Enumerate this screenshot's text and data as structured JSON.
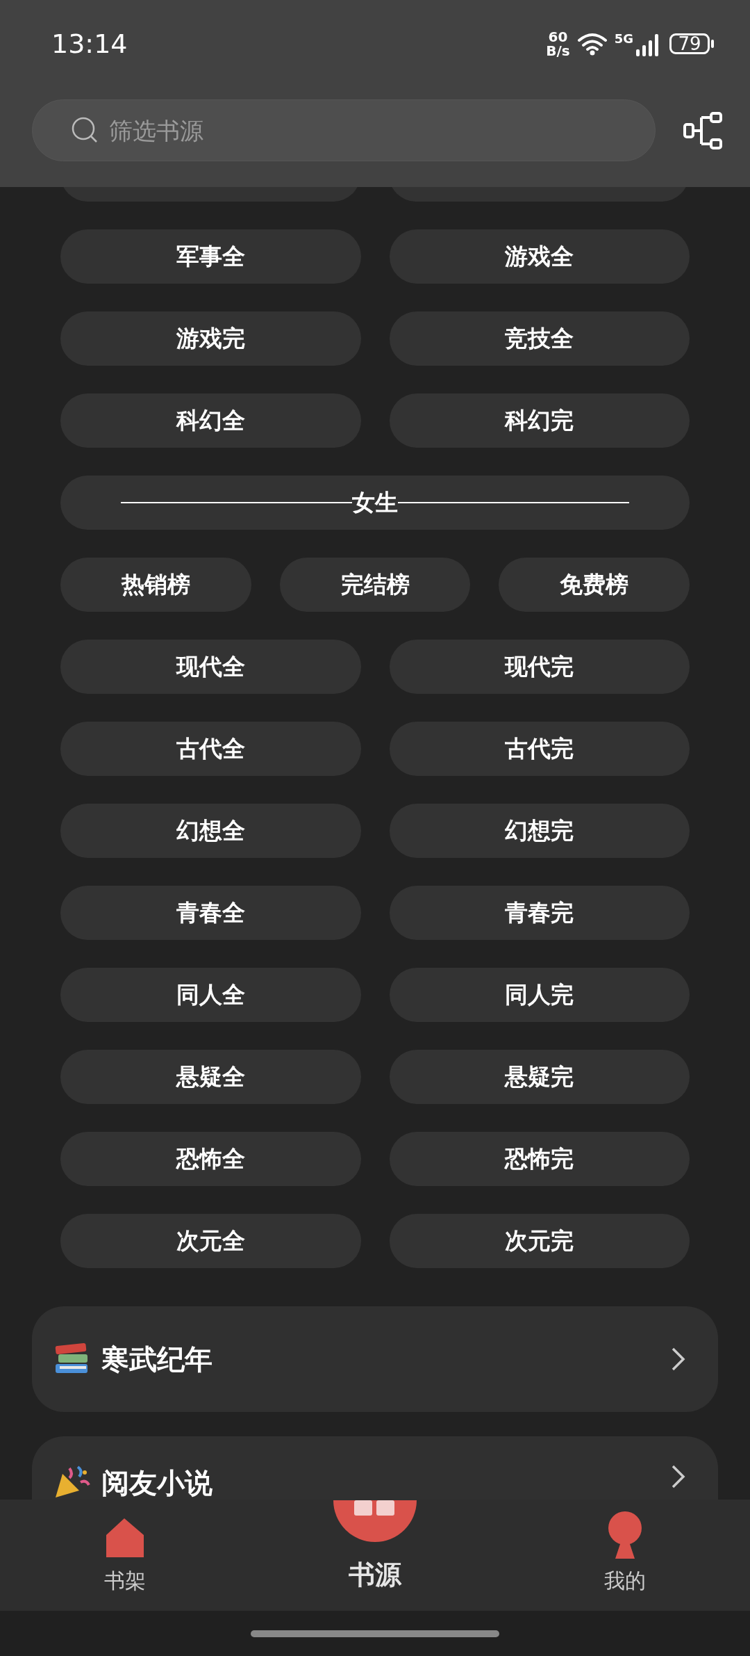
{
  "status_bar": {
    "time": "13:14",
    "net_speed_value": "60",
    "net_speed_unit": "B/s",
    "network": "5G",
    "battery": "79"
  },
  "search": {
    "placeholder": "筛选书源"
  },
  "rows": [
    {
      "kind": "cut_row"
    },
    {
      "kind": "chips",
      "items": [
        "军事全",
        "游戏全"
      ]
    },
    {
      "kind": "chips",
      "items": [
        "游戏完",
        "竞技全"
      ]
    },
    {
      "kind": "chips",
      "items": [
        "科幻全",
        "科幻完"
      ]
    },
    {
      "kind": "divider",
      "label": "女生"
    },
    {
      "kind": "chips",
      "items": [
        "热销榜",
        "完结榜",
        "免费榜"
      ]
    },
    {
      "kind": "chips",
      "items": [
        "现代全",
        "现代完"
      ]
    },
    {
      "kind": "chips",
      "items": [
        "古代全",
        "古代完"
      ]
    },
    {
      "kind": "chips",
      "items": [
        "幻想全",
        "幻想完"
      ]
    },
    {
      "kind": "chips",
      "items": [
        "青春全",
        "青春完"
      ]
    },
    {
      "kind": "chips",
      "items": [
        "同人全",
        "同人完"
      ]
    },
    {
      "kind": "chips",
      "items": [
        "悬疑全",
        "悬疑完"
      ]
    },
    {
      "kind": "chips",
      "items": [
        "恐怖全",
        "恐怖完"
      ]
    },
    {
      "kind": "chips",
      "items": [
        "次元全",
        "次元完"
      ]
    }
  ],
  "cards": [
    {
      "title": "寒武纪年"
    },
    {
      "title": "阅友小说"
    }
  ],
  "bottom_nav": [
    {
      "label": "书架",
      "selected": false
    },
    {
      "label": "书源",
      "selected": true
    },
    {
      "label": "我的",
      "selected": false
    }
  ]
}
